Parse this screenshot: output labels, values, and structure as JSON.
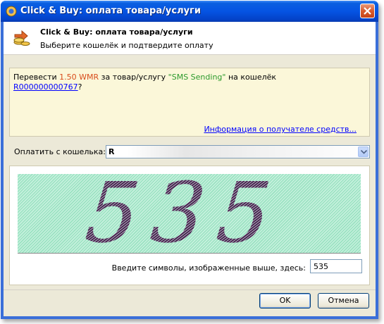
{
  "window": {
    "title": "Click & Buy: оплата товара/услуги"
  },
  "header": {
    "title": "Click & Buy: оплата товара/услуги",
    "subtitle": "Выберите кошелёк и подтвердите оплату"
  },
  "info": {
    "prefix": "Перевести ",
    "amount": "1.50 WMR",
    "mid": " за товар/услугу ",
    "service": "\"SMS Sending\"",
    "suffix": " на кошелёк",
    "wallet": "R000000000767",
    "question": "?",
    "recipient_link": "Информация о получателе средств..."
  },
  "wallet_select": {
    "label": "Оплатить с кошелька:",
    "value": "R"
  },
  "captcha": {
    "image_text": "535",
    "prompt": "Введите символы, изображенные выше, здесь:",
    "input_value": "535"
  },
  "buttons": {
    "ok": "OK",
    "cancel": "Отмена"
  },
  "colors": {
    "title_bar": "#0554e3",
    "amount": "#d84c1c",
    "service": "#2c9a2c",
    "link": "#0000ff",
    "captcha_digits": "#4a1a4e"
  },
  "icons": {
    "title": "webmoney-icon",
    "header": "coins-transfer-icon",
    "close": "close-icon",
    "dropdown": "chevron-down-icon"
  }
}
